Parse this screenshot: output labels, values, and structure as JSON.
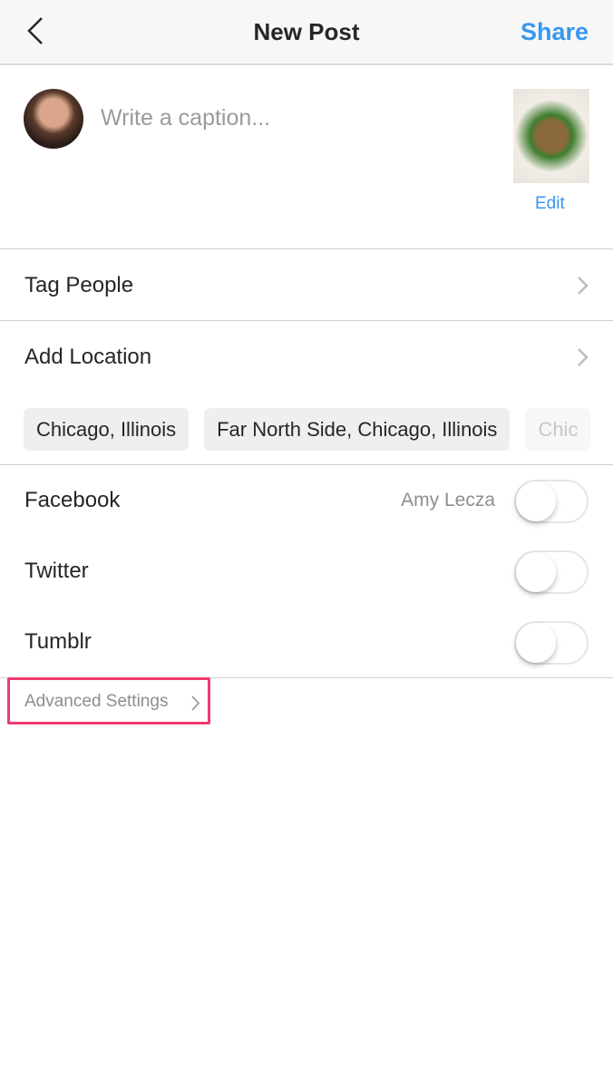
{
  "header": {
    "title": "New Post",
    "share_label": "Share"
  },
  "caption": {
    "placeholder": "Write a caption...",
    "edit_label": "Edit"
  },
  "tag_people": {
    "label": "Tag People"
  },
  "add_location": {
    "label": "Add Location",
    "suggestions": [
      "Chicago, Illinois",
      "Far North Side, Chicago, Illinois",
      "Chic"
    ]
  },
  "social": [
    {
      "label": "Facebook",
      "account": "Amy Lecza",
      "enabled": false
    },
    {
      "label": "Twitter",
      "enabled": false
    },
    {
      "label": "Tumblr",
      "enabled": false
    }
  ],
  "advanced_settings": {
    "label": "Advanced Settings"
  },
  "colors": {
    "accent": "#3897f0",
    "highlight": "#ee3a6f"
  }
}
